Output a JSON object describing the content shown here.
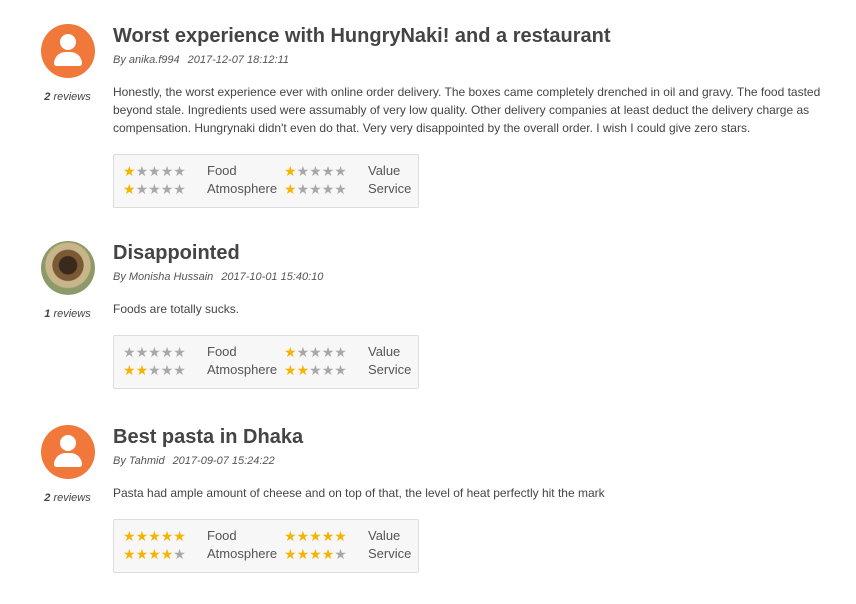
{
  "reviews": [
    {
      "title": "Worst experience with HungryNaki! and a restaurant",
      "author": "By anika.f994",
      "date": "2017-12-07 18:12:11",
      "reviews_count": "2",
      "reviews_word": " reviews",
      "avatar": "user-icon",
      "text": "Honestly, the worst experience ever with online order delivery. The boxes came completely drenched in oil and gravy. The food tasted beyond stale. Ingredients used were assumably of very low quality. Other delivery companies at least deduct the delivery charge as compensation. Hungrynaki didn't even do that. Very very disappointed by the overall order. I wish I could give zero stars.",
      "ratings": {
        "food": 1,
        "value": 1,
        "atmosphere": 1,
        "service": 1
      }
    },
    {
      "title": "Disappointed",
      "author": "By Monisha Hussain",
      "date": "2017-10-01 15:40:10",
      "reviews_count": "1",
      "reviews_word": " reviews",
      "avatar": "photo-avatar",
      "text": "Foods are totally sucks.",
      "ratings": {
        "food": 0,
        "value": 1,
        "atmosphere": 2,
        "service": 2
      }
    },
    {
      "title": "Best pasta in Dhaka",
      "author": "By Tahmid",
      "date": "2017-09-07 15:24:22",
      "reviews_count": "2",
      "reviews_word": " reviews",
      "avatar": "user-icon",
      "text": "Pasta had ample amount of cheese and on top of that, the level of heat perfectly hit the mark",
      "ratings": {
        "food": 5,
        "value": 5,
        "atmosphere": 4,
        "service": 4
      }
    }
  ],
  "labels": {
    "food": "Food",
    "value": "Value",
    "atmosphere": "Atmosphere",
    "service": "Service"
  },
  "colors": {
    "star_on": "#f5b400",
    "star_off": "#a8a8a8",
    "avatar_bg": "#f0783a"
  }
}
